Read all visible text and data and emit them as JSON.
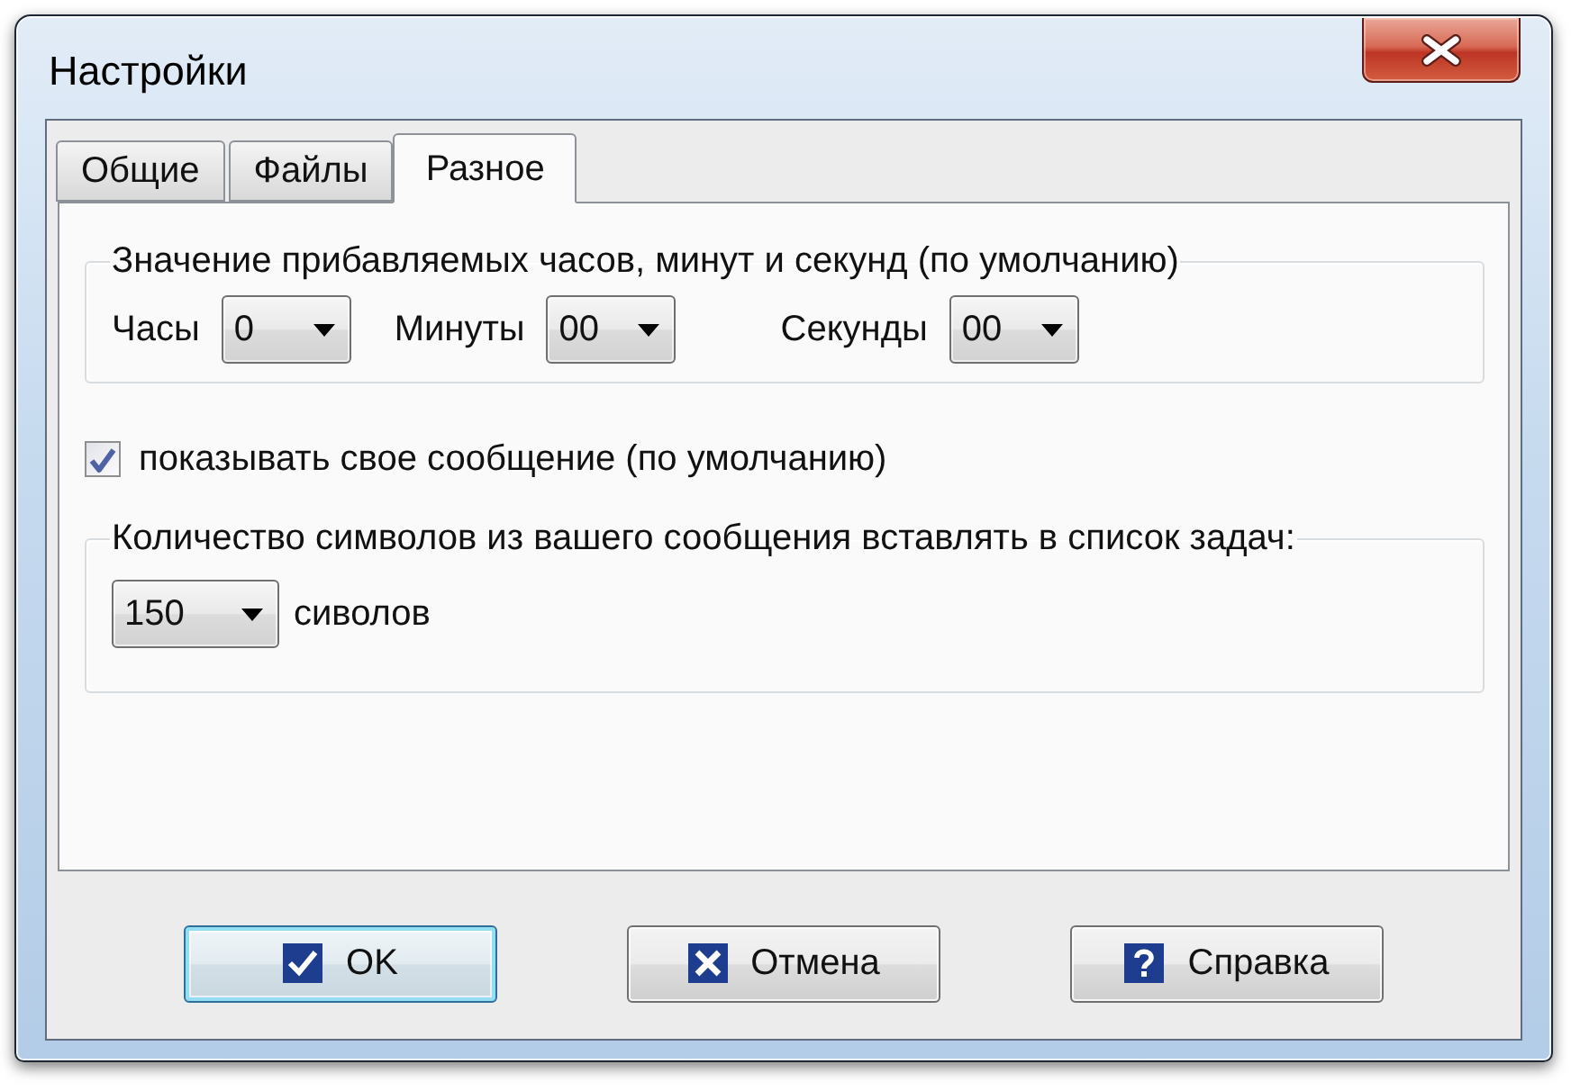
{
  "window": {
    "title": "Настройки"
  },
  "tabs": [
    {
      "label": "Общие",
      "selected": false
    },
    {
      "label": "Файлы",
      "selected": false
    },
    {
      "label": "Разное",
      "selected": true
    }
  ],
  "time_group": {
    "legend": "Значение прибавляемых часов, минут и секунд (по умолчанию)",
    "fields": [
      {
        "label": "Часы",
        "value": "0"
      },
      {
        "label": "Минуты",
        "value": "00"
      },
      {
        "label": "Секунды",
        "value": "00"
      }
    ]
  },
  "show_message": {
    "label": "показывать свое сообщение (по умолчанию)",
    "checked": true
  },
  "length_group": {
    "legend": "Количество символов из вашего сообщения вставлять в список задач:",
    "value": "150",
    "unit": "сиволов"
  },
  "buttons": [
    {
      "kind": "ok",
      "label": "OK",
      "default": true
    },
    {
      "kind": "cancel",
      "label": "Отмена",
      "default": false
    },
    {
      "kind": "help",
      "label": "Справка",
      "default": false
    }
  ]
}
